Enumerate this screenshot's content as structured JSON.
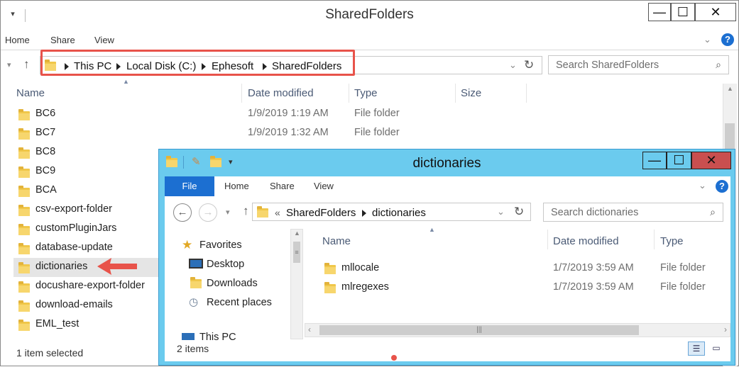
{
  "main_window": {
    "title": "SharedFolders",
    "qa_menu": "▾",
    "controls": {
      "minimize": "—",
      "maximize": "☐",
      "close": "✕"
    },
    "ribbon_tabs": [
      "Home",
      "Share",
      "View"
    ],
    "help": "?",
    "path": [
      "This PC",
      "Local Disk (C:)",
      "Ephesoft",
      "SharedFolders"
    ],
    "search_placeholder": "Search SharedFolders",
    "columns": [
      "Name",
      "Date modified",
      "Type",
      "Size"
    ],
    "rows": [
      {
        "name": "BC6",
        "date": "1/9/2019 1:19 AM",
        "type": "File folder"
      },
      {
        "name": "BC7",
        "date": "1/9/2019 1:32 AM",
        "type": "File folder"
      },
      {
        "name": "BC8",
        "date": "",
        "type": ""
      },
      {
        "name": "BC9",
        "date": "",
        "type": ""
      },
      {
        "name": "BCA",
        "date": "",
        "type": ""
      },
      {
        "name": "csv-export-folder",
        "date": "",
        "type": ""
      },
      {
        "name": "customPluginJars",
        "date": "",
        "type": ""
      },
      {
        "name": "database-update",
        "date": "",
        "type": ""
      },
      {
        "name": "dictionaries",
        "date": "",
        "type": ""
      },
      {
        "name": "docushare-export-folder",
        "date": "",
        "type": ""
      },
      {
        "name": "download-emails",
        "date": "",
        "type": ""
      },
      {
        "name": "EML_test",
        "date": "",
        "type": ""
      }
    ],
    "status": "1 item selected"
  },
  "second_window": {
    "title": "dictionaries",
    "controls": {
      "minimize": "—",
      "maximize": "☐",
      "close": "✕"
    },
    "ribbon_tabs": [
      "File",
      "Home",
      "Share",
      "View"
    ],
    "help": "?",
    "path_prefix": "«",
    "path": [
      "SharedFolders",
      "dictionaries"
    ],
    "search_placeholder": "Search dictionaries",
    "nav_pane": [
      {
        "label": "Favorites",
        "icon": "star-icon"
      },
      {
        "label": "Desktop",
        "icon": "desktop-icon"
      },
      {
        "label": "Downloads",
        "icon": "downloads-icon"
      },
      {
        "label": "Recent places",
        "icon": "recent-places-icon"
      },
      {
        "label": "This PC",
        "icon": "computer-icon"
      }
    ],
    "columns": [
      "Name",
      "Date modified",
      "Type"
    ],
    "rows": [
      {
        "name": "mllocale",
        "date": "1/7/2019 3:59 AM",
        "type": "File folder"
      },
      {
        "name": "mlregexes",
        "date": "1/7/2019 3:59 AM",
        "type": "File folder"
      }
    ],
    "status": "2 items"
  },
  "accent": {
    "highlight": "#e8534a",
    "file_tab": "#1c6fd1",
    "window_frame": "#6bcbee",
    "close_button": "#c94f4f"
  }
}
